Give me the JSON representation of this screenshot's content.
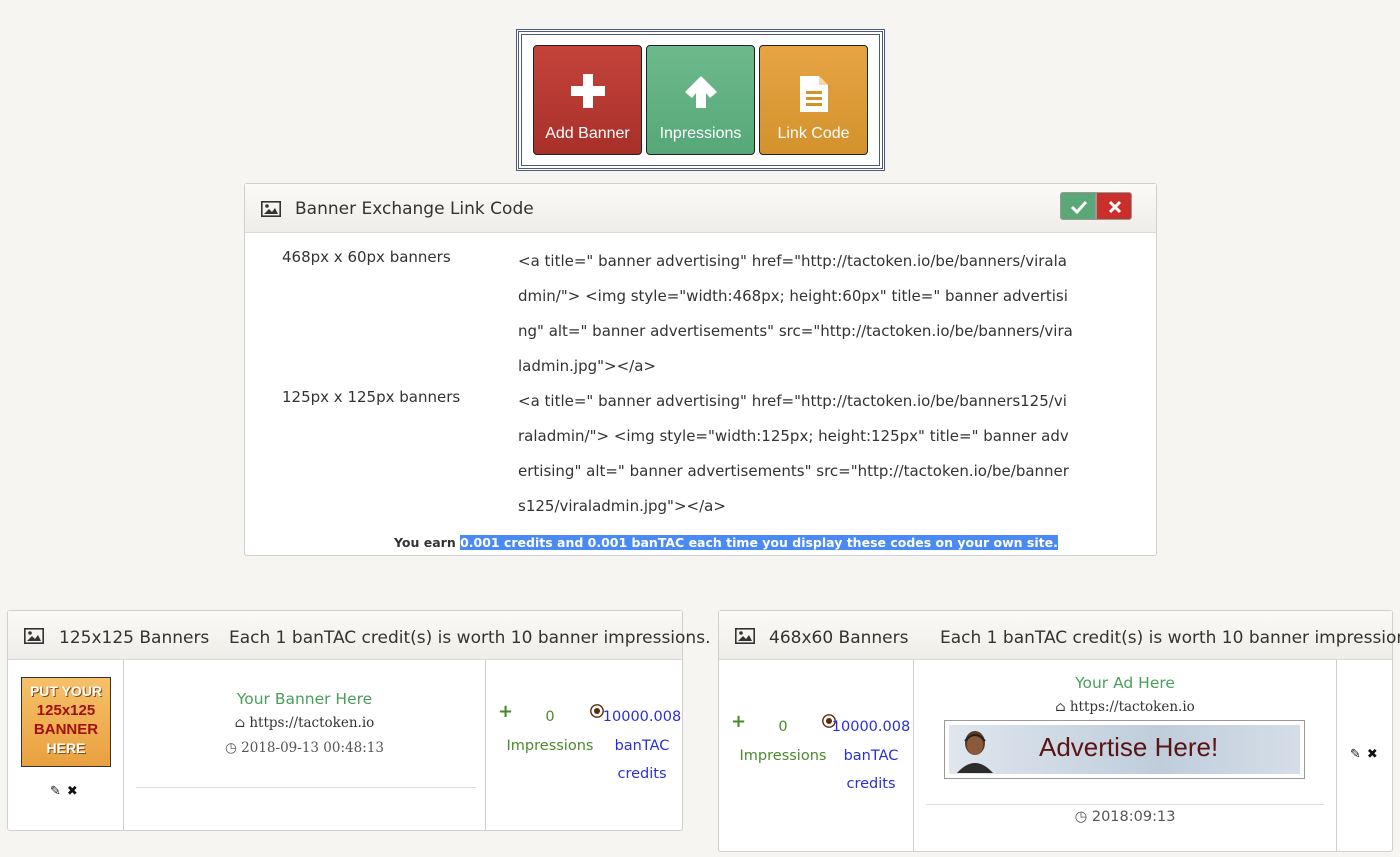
{
  "actions": {
    "add_banner": "Add Banner",
    "impressions": "Inpressions",
    "link_code": "Link Code"
  },
  "link_code_panel": {
    "title": "Banner Exchange Link Code",
    "rows": [
      {
        "label": "468px x 60px banners",
        "code": "<a title=\" banner advertising\" href=\"http://tactoken.io/be/banners/viraladmin/\"> <img style=\"width:468px; height:60px\" title=\" banner advertising\" alt=\" banner advertisements\" src=\"http://tactoken.io/be/banners/viraladmin.jpg\"></a>"
      },
      {
        "label": "125px x 125px banners",
        "code": "<a title=\" banner advertising\" href=\"http://tactoken.io/be/banners125/viraladmin/\"> <img style=\"width:125px; height:125px\" title=\" banner advertising\" alt=\" banner advertisements\" src=\"http://tactoken.io/be/banners125/viraladmin.jpg\"></a>"
      }
    ],
    "earn_prefix": "You earn ",
    "earn_highlight": "0.001 credits and 0.001 banTAC each time you display these codes on your own site."
  },
  "panel_125": {
    "title": "125x125 Banners",
    "note": "Each 1 banTAC credit(s) is worth 10 banner impressions.",
    "banner_image_text": [
      "PUT YOUR",
      "125x125",
      "BANNER",
      "HERE"
    ],
    "banner_title": "Your Banner Here",
    "url": "https://tactoken.io",
    "date": "2018-09-13 00:48:13",
    "impressions_count": "0",
    "impressions_label": "Impressions",
    "credits_value": "10000.008",
    "credits_label": [
      "banTAC",
      "credits"
    ]
  },
  "panel_468": {
    "title": "468x60 Banners",
    "note": "Each 1 banTAC credit(s) is worth 10 banner impressions.",
    "impressions_count": "0",
    "impressions_label": "Impressions",
    "credits_value": "10000.008",
    "credits_label": [
      "banTAC",
      "credits"
    ],
    "banner_title": "Your Ad Here",
    "url": "https://tactoken.io",
    "banner_image_text": "Advertise Here!",
    "date": "2018:09:13"
  },
  "colors": {
    "add_banner": "#b83a32",
    "impressions": "#62b083",
    "link_code": "#dd9b38",
    "highlight": "#4a8af4",
    "credit_blue": "#2b2fd6",
    "title_green": "#4a9e5c"
  }
}
